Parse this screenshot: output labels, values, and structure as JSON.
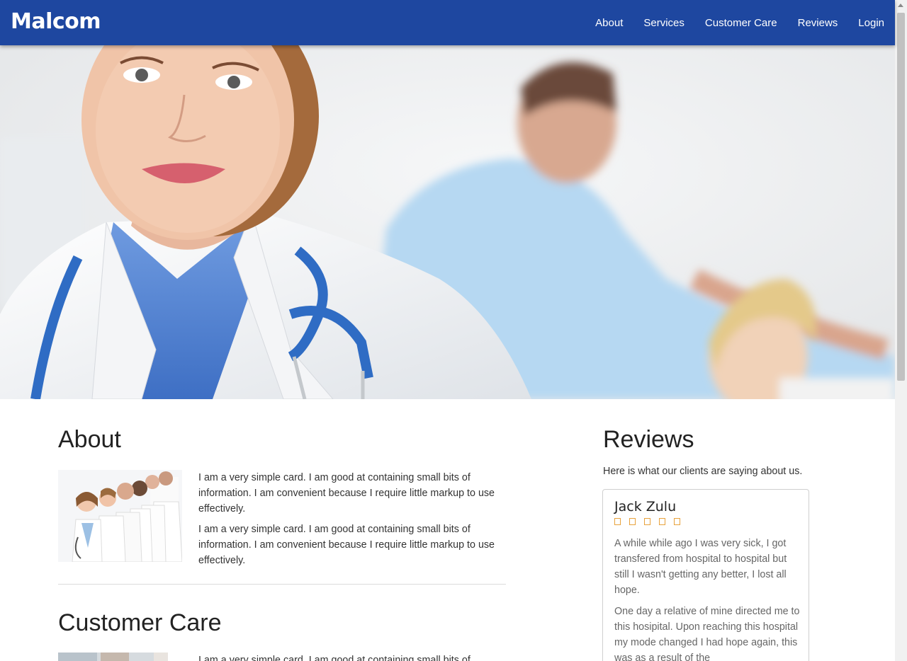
{
  "navbar": {
    "brand": "Malcom",
    "links": [
      "About",
      "Services",
      "Customer Care",
      "Reviews",
      "Login"
    ]
  },
  "about": {
    "title": "About",
    "paragraphs": [
      "I am a very simple card. I am good at containing small bits of information. I am convenient because I require little markup to use effectively.",
      "I am a very simple card. I am good at containing small bits of information. I am convenient because I require little markup to use effectively."
    ]
  },
  "customer_care": {
    "title": "Customer Care",
    "paragraph": "I am a very simple card. I am good at containing small bits of"
  },
  "reviews": {
    "title": "Reviews",
    "subtitle": "Here is what our clients are saying about us.",
    "card": {
      "name": "Jack Zulu",
      "star_count": 5,
      "paragraphs": [
        "A while while ago I was very sick, I got transfered from hospital to hospital but still I wasn't getting any better, I lost all hope.",
        "One day a relative of mine directed me to this hosipital. Upon reaching this hospital my mode changed I had hope again, this was as a result of the"
      ]
    }
  },
  "colors": {
    "navbar": "#1e47a0",
    "star": "#e8a23c"
  }
}
